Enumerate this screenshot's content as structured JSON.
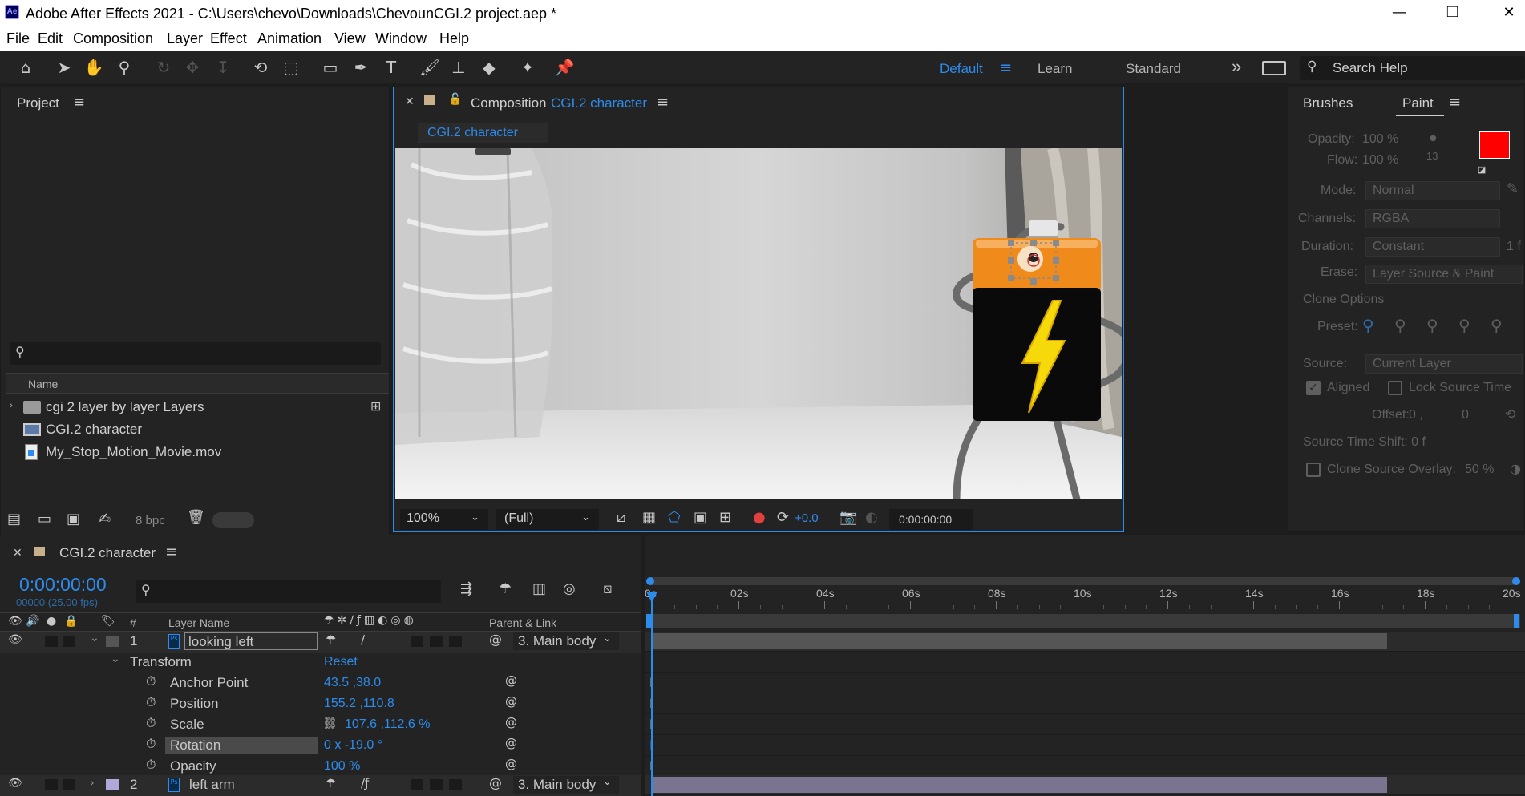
{
  "window": {
    "title": "Adobe After Effects 2021 - C:\\Users\\chevo\\Downloads\\ChevounCGI.2 project.aep *",
    "app_badge": "Ae"
  },
  "menu": [
    "File",
    "Edit",
    "Composition",
    "Layer",
    "Effect",
    "Animation",
    "View",
    "Window",
    "Help"
  ],
  "workspaces": {
    "items": [
      "Default",
      "Learn",
      "Standard"
    ],
    "active": "Default",
    "more": "»"
  },
  "search_help": {
    "label": "Search Help"
  },
  "project": {
    "title": "Project",
    "column_name": "Name",
    "items": [
      {
        "label": "cgi 2 layer by layer Layers",
        "kind": "folder"
      },
      {
        "label": "CGI.2 character",
        "kind": "composition"
      },
      {
        "label": "My_Stop_Motion_Movie.mov",
        "kind": "footage"
      }
    ],
    "bpc": "8 bpc"
  },
  "composition": {
    "panel_label": "Composition",
    "comp_name": "CGI.2 character",
    "tab_label": "CGI.2 character",
    "zoom": "100%",
    "resolution": "(Full)",
    "exposure": "+0.0",
    "timecode": "0:00:00:00"
  },
  "paint": {
    "tabs": [
      "Brushes",
      "Paint"
    ],
    "active_tab": "Paint",
    "opacity_label": "Opacity:",
    "opacity_value": "100 %",
    "flow_label": "Flow:",
    "flow_value": "100 %",
    "brush_size": "13",
    "mode_label": "Mode:",
    "mode_value": "Normal",
    "channels_label": "Channels:",
    "channels_value": "RGBA",
    "duration_label": "Duration:",
    "duration_value": "Constant",
    "duration_suffix": "1 f",
    "erase_label": "Erase:",
    "erase_value": "Layer Source & Paint",
    "clone_options": "Clone Options",
    "preset_label": "Preset:",
    "source_label": "Source:",
    "source_value": "Current Layer",
    "aligned": "Aligned",
    "lock_source_time": "Lock Source Time",
    "offset_label": "Offset:",
    "offset_x": "0 ,",
    "offset_y": "0",
    "source_time_shift": "Source Time Shift:  0  f",
    "clone_overlay_label": "Clone Source Overlay:",
    "clone_overlay_value": "50 %",
    "foreground_color": "#ff0000",
    "background_color": "#ffffff"
  },
  "timeline": {
    "tab_label": "CGI.2 character",
    "timecode": "0:00:00:00",
    "timecode_sub": "00000 (25.00 fps)",
    "col_hash": "#",
    "col_layer_name": "Layer Name",
    "col_parent": "Parent & Link",
    "ruler": [
      "0s",
      "02s",
      "04s",
      "06s",
      "08s",
      "10s",
      "12s",
      "14s",
      "16s",
      "18s",
      "20s"
    ],
    "layers": [
      {
        "index": "1",
        "name": "looking left",
        "parent": "3. Main body",
        "label_color": "#555555"
      },
      {
        "index": "2",
        "name": "left arm",
        "parent": "3. Main body",
        "label_color": "#b0a8d8"
      }
    ],
    "transform": {
      "label": "Transform",
      "reset": "Reset",
      "props": [
        {
          "name": "Anchor Point",
          "value": "43.5 ,38.0"
        },
        {
          "name": "Position",
          "value": "155.2 ,110.8"
        },
        {
          "name": "Scale",
          "value": "107.6 ,112.6 %"
        },
        {
          "name": "Rotation",
          "value": "0 x -19.0 °"
        },
        {
          "name": "Opacity",
          "value": "100 %"
        }
      ]
    }
  }
}
